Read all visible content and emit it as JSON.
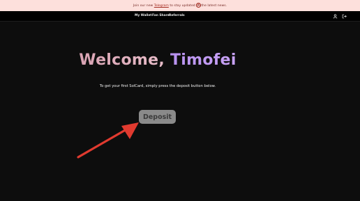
{
  "banner": {
    "text_before": "Join our new",
    "link_text": "Telegram",
    "text_after": "to stay updated on the latest news.",
    "close_symbol": "×"
  },
  "nav": {
    "items": [
      {
        "label": "My Wallet"
      },
      {
        "label": "Fan Share"
      },
      {
        "label": "Referrals"
      }
    ],
    "icons": [
      "user-icon",
      "logout-icon"
    ]
  },
  "hero": {
    "greeting": "Welcome,",
    "name": "Timofei",
    "subtitle": "To get your first SolCard, simply press the deposit button below."
  },
  "deposit": {
    "label": "Deposit"
  },
  "annotation": {
    "arrow_color": "#e03a2f"
  },
  "colors": {
    "banner_bg": "#fde0dc",
    "page_bg": "#0d0d0d",
    "button_bg": "#8a8a8a"
  }
}
